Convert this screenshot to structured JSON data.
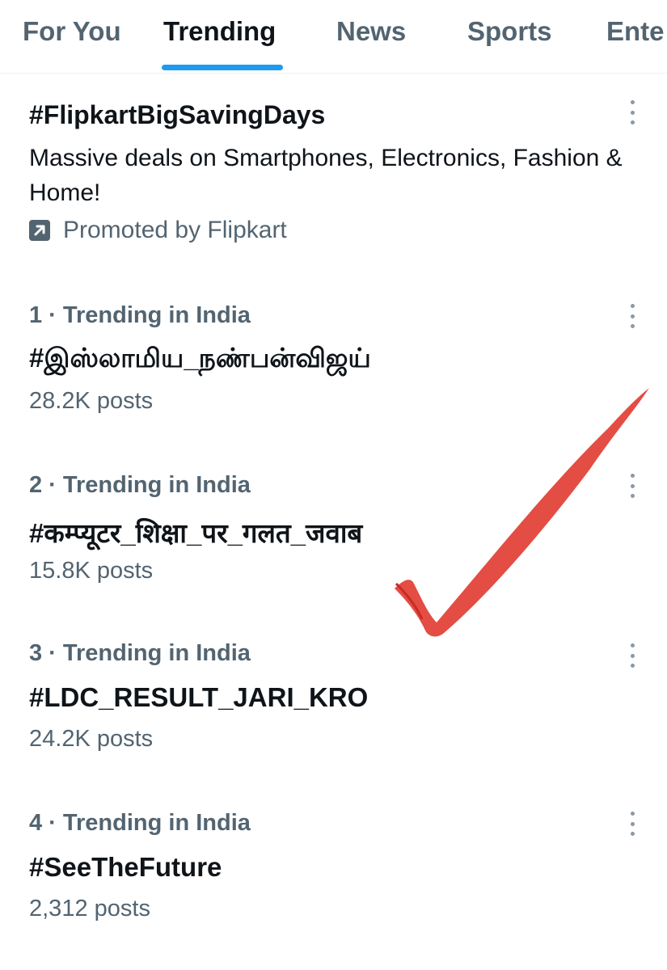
{
  "tabs": [
    {
      "label": "For You",
      "active": false
    },
    {
      "label": "Trending",
      "active": true
    },
    {
      "label": "News",
      "active": false
    },
    {
      "label": "Sports",
      "active": false
    },
    {
      "label": "Ente",
      "active": false
    }
  ],
  "accent_color": "#1d9bf0",
  "promoted": {
    "title": "#FlipkartBigSavingDays",
    "description": "Massive deals on Smartphones, Electronics, Fashion & Home!",
    "promoted_by": "Promoted by Flipkart",
    "icon": "promoted-arrow-icon"
  },
  "trends": [
    {
      "context": "1 · Trending in India",
      "tag": "#இஸ்லாமிய_நண்பன்விஜய்",
      "posts": "28.2K posts"
    },
    {
      "context": "2 · Trending in India",
      "tag": "#कम्प्यूटर_शिक्षा_पर_गलत_जवाब",
      "posts": "15.8K posts"
    },
    {
      "context": "3 · Trending in India",
      "tag": "#LDC_RESULT_JARI_KRO",
      "posts": "24.2K posts"
    },
    {
      "context": "4 · Trending in India",
      "tag": "#SeeTheFuture",
      "posts": "2,312 posts"
    }
  ],
  "more_icon": "more-vertical-icon",
  "annotation": {
    "icon": "red-checkmark-icon",
    "color": "#e03a30"
  }
}
